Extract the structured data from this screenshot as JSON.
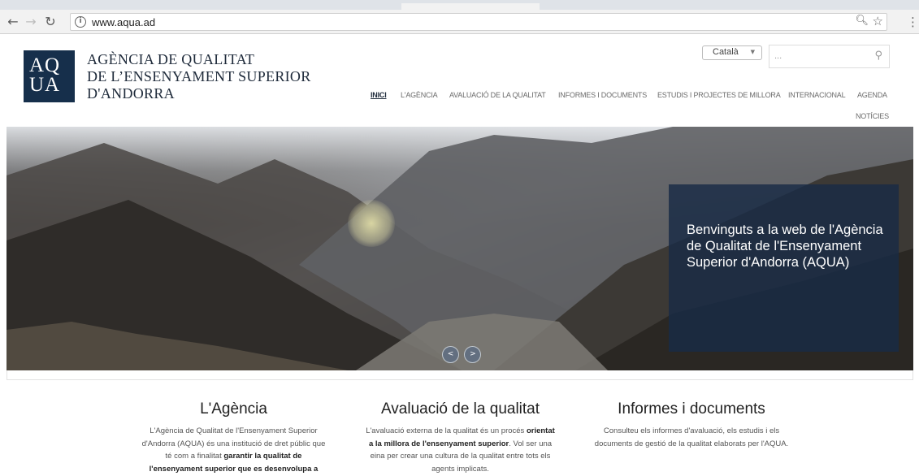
{
  "browser": {
    "url": "www.aqua.ad"
  },
  "site": {
    "logo_line1": "AQ",
    "logo_line2": "UA",
    "title_line1": "AGÈNCIA DE QUALITAT",
    "title_line2": "DE L’ENSENYAMENT SUPERIOR",
    "title_line3": "D'ANDORRA"
  },
  "header": {
    "language": "Català",
    "search_placeholder": "..."
  },
  "nav": {
    "items": [
      {
        "label": "INICI"
      },
      {
        "label": "L'AGÈNCIA"
      },
      {
        "label": "AVALUACIÓ DE LA QUALITAT"
      },
      {
        "label": "INFORMES I DOCUMENTS"
      },
      {
        "label": "ESTUDIS I PROJECTES DE MILLORA"
      },
      {
        "label": "INTERNACIONAL"
      },
      {
        "label": "AGENDA"
      },
      {
        "label": "NOTÍCIES"
      }
    ]
  },
  "hero": {
    "caption": "Benvinguts a la web de l'Agència de Qualitat de l'Ensenyament Superior d'Andorra (AQUA)",
    "prev_symbol": "<",
    "next_symbol": ">"
  },
  "columns": [
    {
      "title": "L'Agència",
      "text_1": "L'Agència de Qualitat de l'Ensenyament Superior d'Andorra (AQUA) és una institució de dret públic que té com a finalitat ",
      "bold_1": "garantir la qualitat de l'ensenyament superior que es desenvolupa a"
    },
    {
      "title": "Avaluació de la qualitat",
      "text_1": "L'avaluació externa de la qualitat és un procés ",
      "bold_1": "orientat a la millora de l'ensenyament superior",
      "text_2": ". Vol ser una eina per crear una cultura de la qualitat entre tots els agents implicats."
    },
    {
      "title": "Informes i documents",
      "text_1": "Consulteu els informes d'avaluació, els estudis i els documents de gestió de la qualitat elaborats per l'AQUA."
    }
  ],
  "colors": {
    "brand_navy": "#162f4b",
    "caption_panel": "#182b46"
  }
}
